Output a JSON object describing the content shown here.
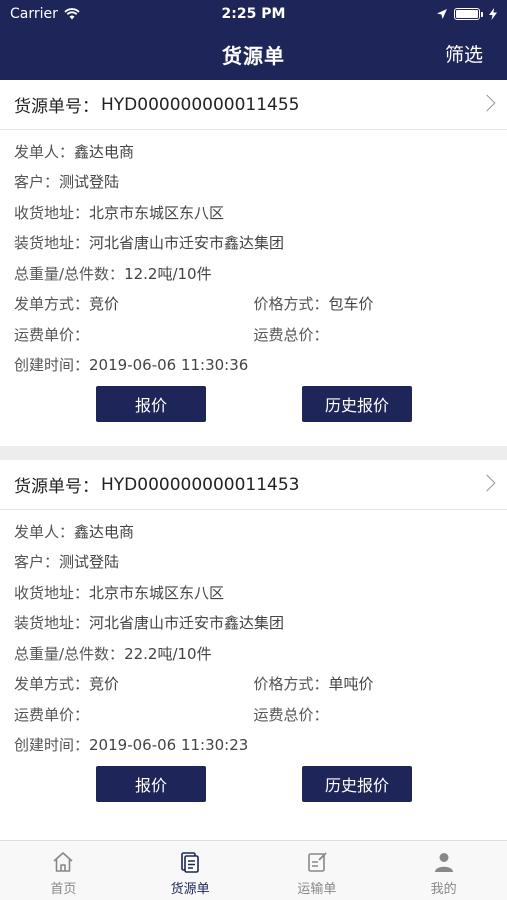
{
  "status_bar": {
    "carrier": "Carrier",
    "time": "2:25 PM"
  },
  "nav": {
    "title": "货源单",
    "filter": "筛选"
  },
  "cards": [
    {
      "order_label": "货源单号：",
      "order_no": "HYD000000000011455",
      "sender_label": "发单人：",
      "sender": "鑫达电商",
      "customer_label": "客户：",
      "customer": "测试登陆",
      "recv_label": "收货地址：",
      "recv": "北京市东城区东八区",
      "load_label": "装货地址：",
      "load": "河北省唐山市迁安市鑫达集团",
      "weight_label": "总重量/总件数：",
      "weight": "12.2吨/10件",
      "mode_label": "发单方式：",
      "mode": "竞价",
      "price_mode_label": "价格方式：",
      "price_mode": "包车价",
      "unit_price_label": "运费单价：",
      "unit_price": "",
      "total_price_label": "运费总价：",
      "total_price": "",
      "created_label": "创建时间：",
      "created": "2019-06-06 11:30:36",
      "quote_btn": "报价",
      "history_btn": "历史报价"
    },
    {
      "order_label": "货源单号：",
      "order_no": "HYD000000000011453",
      "sender_label": "发单人：",
      "sender": "鑫达电商",
      "customer_label": "客户：",
      "customer": "测试登陆",
      "recv_label": "收货地址：",
      "recv": "北京市东城区东八区",
      "load_label": "装货地址：",
      "load": "河北省唐山市迁安市鑫达集团",
      "weight_label": "总重量/总件数：",
      "weight": "22.2吨/10件",
      "mode_label": "发单方式：",
      "mode": "竞价",
      "price_mode_label": "价格方式：",
      "price_mode": "单吨价",
      "unit_price_label": "运费单价：",
      "unit_price": "",
      "total_price_label": "运费总价：",
      "total_price": "",
      "created_label": "创建时间：",
      "created": "2019-06-06 11:30:23",
      "quote_btn": "报价",
      "history_btn": "历史报价"
    }
  ],
  "tabbar": {
    "items": [
      {
        "label": "首页",
        "icon": "home-icon"
      },
      {
        "label": "货源单",
        "icon": "document-icon"
      },
      {
        "label": "运输单",
        "icon": "edit-note-icon"
      },
      {
        "label": "我的",
        "icon": "user-icon"
      }
    ],
    "active_color": "#1e2558",
    "inactive_color": "#888888"
  },
  "colors": {
    "brand": "#1e2558",
    "background": "#ededed"
  }
}
